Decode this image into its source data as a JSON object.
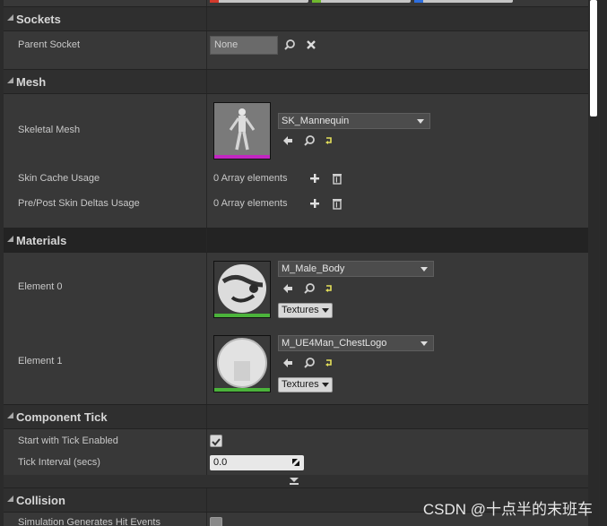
{
  "top_chips": [
    {
      "color": "#d33a2c"
    },
    {
      "color": "#6fb82e"
    },
    {
      "color": "#2d6fe0"
    }
  ],
  "sections": {
    "sockets": {
      "title": "Sockets",
      "parent_socket_label": "Parent Socket",
      "parent_socket_value": "None"
    },
    "mesh": {
      "title": "Mesh",
      "skeletal_mesh_label": "Skeletal Mesh",
      "skeletal_mesh_value": "SK_Mannequin",
      "skeletal_mesh_bar_color": "#c226c2",
      "skin_cache_label": "Skin Cache Usage",
      "skin_cache_value": "0 Array elements",
      "skin_deltas_label": "Pre/Post Skin Deltas Usage",
      "skin_deltas_value": "0 Array elements"
    },
    "materials": {
      "title": "Materials",
      "element0_label": "Element 0",
      "element0_value": "M_Male_Body",
      "element0_textures": "Textures",
      "element1_label": "Element 1",
      "element1_value": "M_UE4Man_ChestLogo",
      "element1_textures": "Textures",
      "material_bar_color": "#4bb33b"
    },
    "component_tick": {
      "title": "Component Tick",
      "start_tick_label": "Start with Tick Enabled",
      "start_tick_checked": true,
      "tick_interval_label": "Tick Interval (secs)",
      "tick_interval_value": "0.0"
    },
    "collision": {
      "title": "Collision",
      "sim_hit_label": "Simulation Generates Hit Events"
    }
  },
  "watermark": "CSDN @十点半的末班车"
}
